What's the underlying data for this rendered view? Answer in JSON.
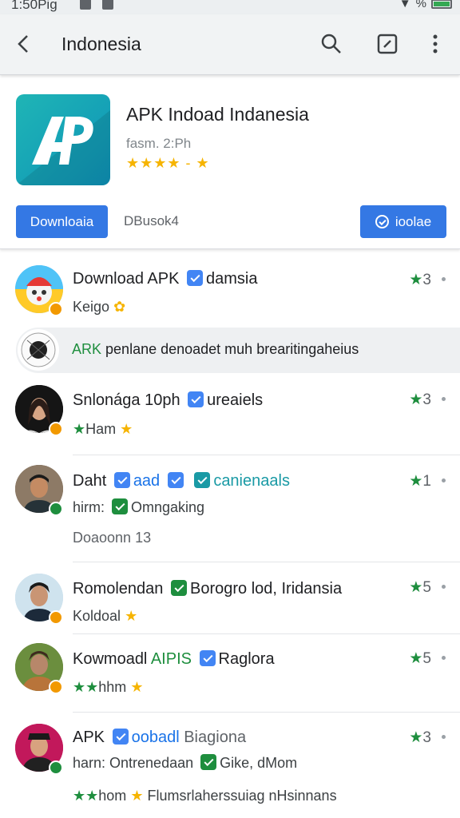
{
  "status_bar": {
    "time": "1:50Pig",
    "battery_label": "%"
  },
  "app_bar": {
    "title": "Indonesia"
  },
  "app": {
    "name": "APK Indoad Indanesia",
    "meta": "fasm. 2:Ph",
    "rating_stars": "★★★★ - ★",
    "download_label": "Downloaia",
    "secondary_label": "DBusok4",
    "follow_label": "ioolae"
  },
  "items": [
    {
      "title": "Download APK",
      "title_tail": "damsia",
      "sub": "Keigo",
      "score": "3",
      "badge": "orange"
    },
    {
      "title": "Snlonága 10ph",
      "title_tail": "ureaiels",
      "sub_prefix": "★",
      "sub": "Ham",
      "score": "3",
      "badge": "orange"
    },
    {
      "title": "Daht",
      "title_mid": "aad",
      "title_tail": "canienaals",
      "sub": "hirm:",
      "sub_tail": "Omngaking",
      "extra": "Doaoonn 13",
      "score": "1",
      "badge": "green"
    },
    {
      "title": "Romolendan",
      "title_tail": "Borogro lod, Iridansia",
      "sub": "Koldoal",
      "score": "5",
      "badge": "orange"
    },
    {
      "title": "Kowmoadl",
      "title_green": "AIPIS",
      "title_tail": "Raglora",
      "sub_prefix": "★★",
      "sub": "hhm",
      "score": "5",
      "badge": "orange"
    },
    {
      "title": "APK",
      "title_blue": "oobadl",
      "title_tail": "Biagiona",
      "sub": "harn: Ontrenedaan",
      "sub_tail": "Gike, dMom",
      "extra_prefix": "★★",
      "extra": "hom",
      "extra_tail": "Flumsrlaherssuiag nHsinnans",
      "score": "3",
      "badge": "green"
    }
  ],
  "banner": {
    "label": "ARK",
    "text": "penlane denoadet muh brearitingaheius"
  },
  "colors": {
    "primary": "#3478e4",
    "green": "#1e8e3e",
    "star": "#f6b400",
    "teal": "#1fb5b5"
  },
  "icons": [
    "back-arrow-icon",
    "search-icon",
    "external-link-icon",
    "more-vert-icon",
    "check-icon",
    "star-icon"
  ]
}
